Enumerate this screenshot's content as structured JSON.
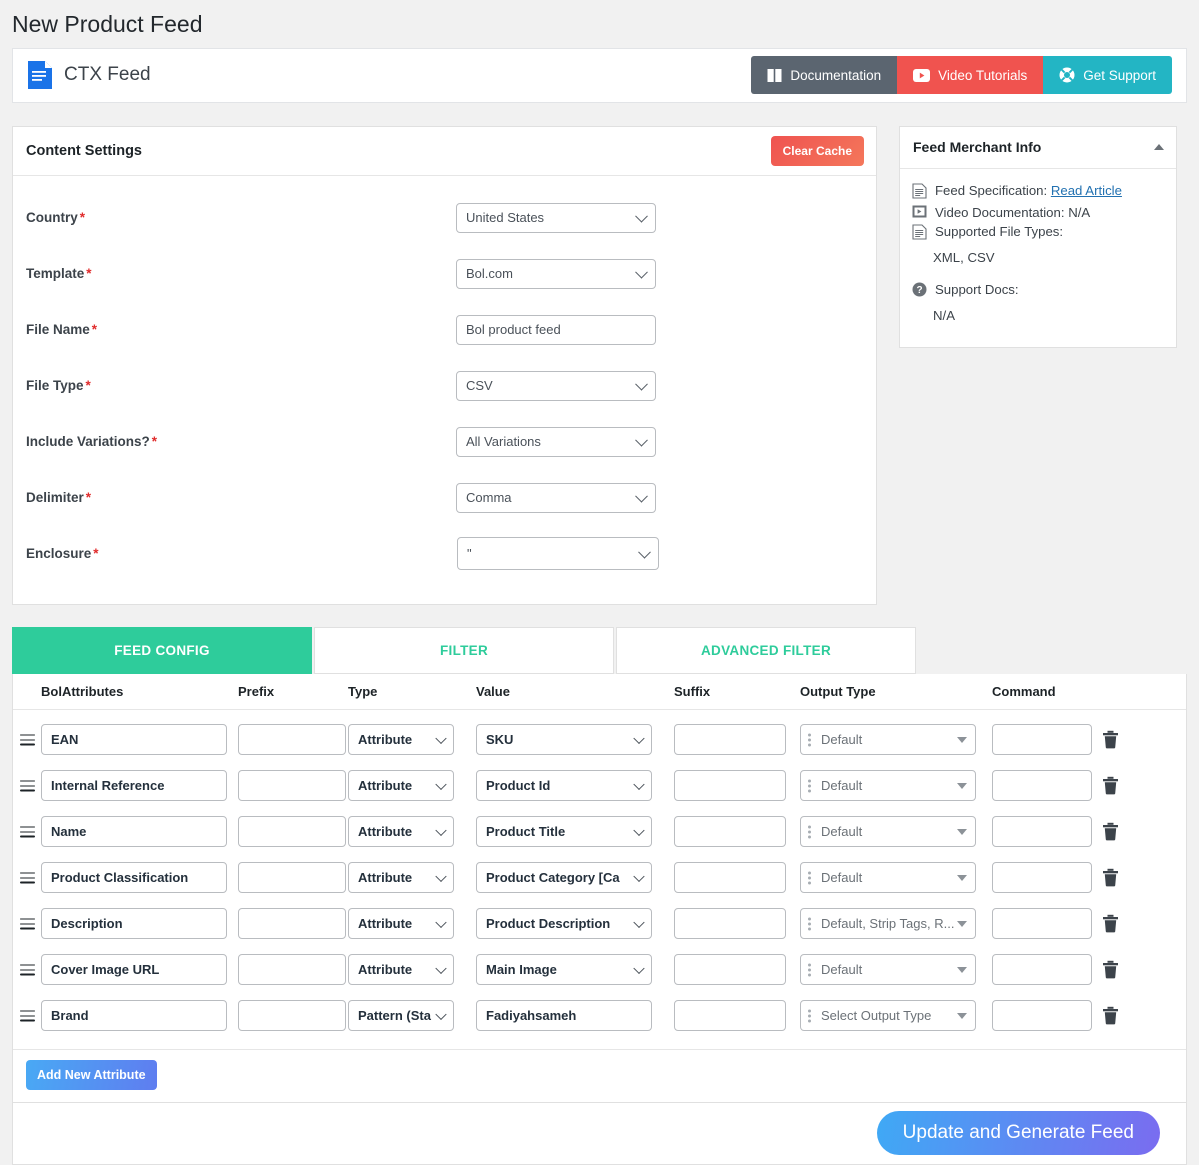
{
  "page": {
    "title": "New Product Feed"
  },
  "brand": {
    "name": "CTX Feed"
  },
  "help_buttons": [
    {
      "label": "Documentation",
      "icon": "book-icon",
      "color": "#5b6570"
    },
    {
      "label": "Video Tutorials",
      "icon": "youtube-icon",
      "color": "#f0534f"
    },
    {
      "label": "Get Support",
      "icon": "lifebuoy-icon",
      "color": "#23b5c4"
    }
  ],
  "content_settings": {
    "heading": "Content Settings",
    "clear_cache_label": "Clear Cache",
    "fields": [
      {
        "label": "Country",
        "required": "*",
        "value": "United States",
        "kind": "select"
      },
      {
        "label": "Template",
        "required": "*",
        "value": "Bol.com",
        "kind": "select"
      },
      {
        "label": "File Name",
        "required": "*",
        "value": "Bol product feed",
        "kind": "text"
      },
      {
        "label": "File Type",
        "required": "*",
        "value": "CSV",
        "kind": "select"
      },
      {
        "label": "Include Variations?",
        "required": "*",
        "value": "All Variations",
        "kind": "select"
      },
      {
        "label": "Delimiter",
        "required": "*",
        "value": "Comma",
        "kind": "select"
      },
      {
        "label": "Enclosure",
        "required": "*",
        "value": "\"",
        "kind": "select"
      }
    ]
  },
  "merchant_info": {
    "heading": "Feed Merchant Info",
    "lines": [
      {
        "icon": "document-icon",
        "label": "Feed Specification:",
        "link": "Read Article",
        "sub": ""
      },
      {
        "icon": "video-icon",
        "label": "Video Documentation:",
        "value": "N/A",
        "sub": ""
      },
      {
        "icon": "document-icon",
        "label": "Supported File Types:",
        "sub": "XML, CSV"
      },
      {
        "icon": "question-icon",
        "label": "Support Docs:",
        "sub": "N/A"
      }
    ]
  },
  "tabs": [
    {
      "label": "FEED CONFIG",
      "active": true
    },
    {
      "label": "FILTER",
      "active": false
    },
    {
      "label": "ADVANCED FILTER",
      "active": false
    }
  ],
  "table": {
    "columns": [
      "BolAttributes",
      "Prefix",
      "Type",
      "Value",
      "Suffix",
      "Output Type",
      "Command"
    ],
    "rows": [
      {
        "attribute": "EAN",
        "prefix": "",
        "type": "Attribute",
        "value": "SKU",
        "value_kind": "select",
        "suffix": "",
        "output": "Default",
        "command": ""
      },
      {
        "attribute": "Internal Reference",
        "prefix": "",
        "type": "Attribute",
        "value": "Product Id",
        "value_kind": "select",
        "suffix": "",
        "output": "Default",
        "command": ""
      },
      {
        "attribute": "Name",
        "prefix": "",
        "type": "Attribute",
        "value": "Product Title",
        "value_kind": "select",
        "suffix": "",
        "output": "Default",
        "command": ""
      },
      {
        "attribute": "Product Classification",
        "prefix": "",
        "type": "Attribute",
        "value": "Product Category [Ca",
        "value_kind": "select",
        "suffix": "",
        "output": "Default",
        "command": ""
      },
      {
        "attribute": "Description",
        "prefix": "",
        "type": "Attribute",
        "value": "Product Description",
        "value_kind": "select",
        "suffix": "",
        "output": "Default, Strip Tags, R...",
        "command": ""
      },
      {
        "attribute": "Cover Image URL",
        "prefix": "",
        "type": "Attribute",
        "value": "Main Image",
        "value_kind": "select",
        "suffix": "",
        "output": "Default",
        "command": ""
      },
      {
        "attribute": "Brand",
        "prefix": "",
        "type": "Pattern (Sta",
        "value": "Fadiyahsameh",
        "value_kind": "text",
        "suffix": "",
        "output": "Select Output Type",
        "command": ""
      }
    ],
    "add_button_label": "Add New Attribute",
    "delete_icon": "trash-icon"
  },
  "footer": {
    "generate_label": "Update and Generate Feed"
  },
  "colors": {
    "accent_green": "#2ecc9b",
    "danger_red": "#ef5350",
    "link_blue": "#2271b1",
    "primary_blue": "#3fa9f5",
    "purple": "#7a6cf0"
  }
}
